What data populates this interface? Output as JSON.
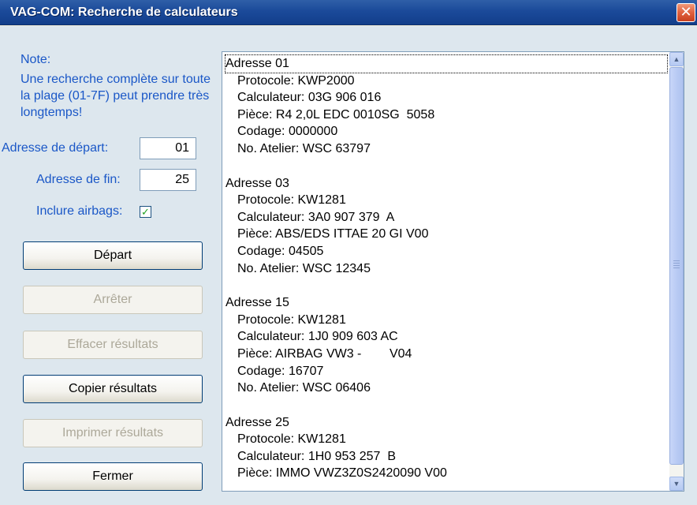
{
  "window": {
    "title": "VAG-COM:  Recherche de calculateurs",
    "close_symbol": "✕"
  },
  "note": {
    "label": "Note:",
    "text": "Une recherche complète sur toute la plage (01-7F) peut prendre très longtemps!"
  },
  "form": {
    "start_label": "Adresse de départ:",
    "start_value": "01",
    "end_label": "Adresse de fin:",
    "end_value": "25",
    "airbag_label": "Inclure airbags:",
    "airbag_checked": true
  },
  "buttons": {
    "start": "Départ",
    "stop": "Arrêter",
    "clear": "Effacer résultats",
    "copy": "Copier résultats",
    "print": "Imprimer résultats",
    "close": "Fermer"
  },
  "results": [
    {
      "header": "Adresse 01",
      "lines": [
        "Protocole: KWP2000",
        "Calculateur: 03G 906 016",
        "Pièce: R4 2,0L EDC 0010SG  5058",
        "Codage: 0000000",
        "No. Atelier: WSC 63797"
      ]
    },
    {
      "header": "Adresse 03",
      "lines": [
        "Protocole: KW1281",
        "Calculateur: 3A0 907 379  A",
        "Pièce: ABS/EDS ITTAE 20 GI V00",
        "Codage: 04505",
        "No. Atelier: WSC 12345"
      ]
    },
    {
      "header": "Adresse 15",
      "lines": [
        "Protocole: KW1281",
        "Calculateur: 1J0 909 603 AC",
        "Pièce: AIRBAG VW3 -        V04",
        "Codage: 16707",
        "No. Atelier: WSC 06406"
      ]
    },
    {
      "header": "Adresse 25",
      "lines": [
        "Protocole: KW1281",
        "Calculateur: 1H0 953 257  B",
        "Pièce: IMMO VWZ3Z0S2420090 V00"
      ]
    }
  ],
  "icons": {
    "scroll_up": "scroll-up-arrow",
    "scroll_down": "scroll-down-arrow",
    "checkmark": "checkmark"
  },
  "colors": {
    "titlebar": "#1b4a9a",
    "label_blue": "#1a57c7",
    "dialog_background": "#dde7ee"
  }
}
